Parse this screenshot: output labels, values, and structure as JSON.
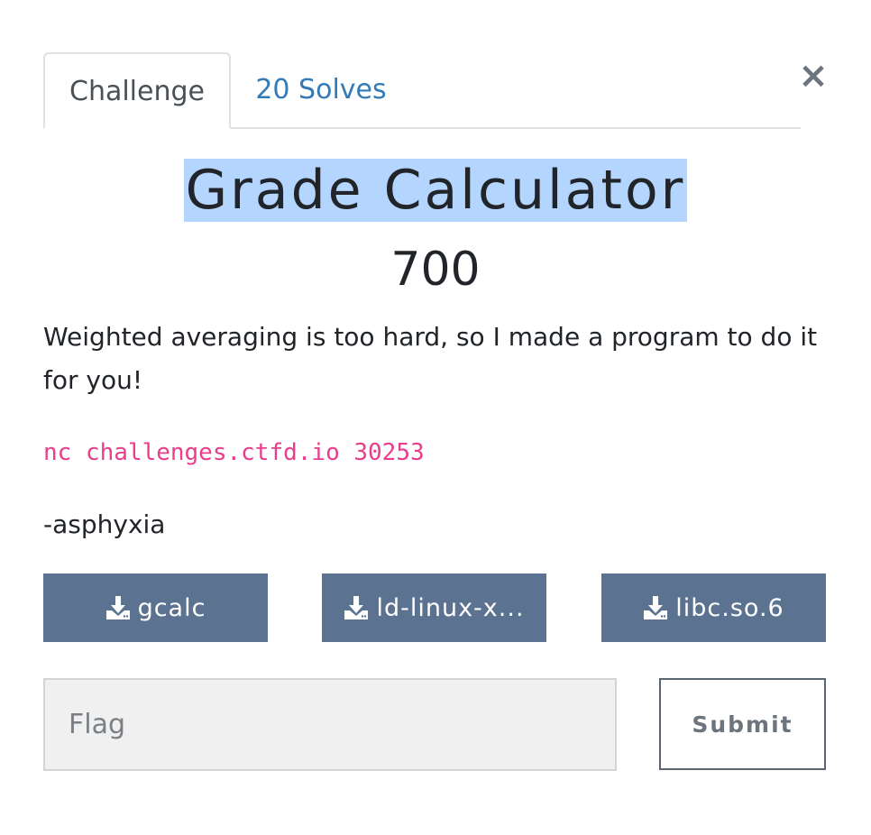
{
  "tabs": {
    "challenge_label": "Challenge",
    "solves_label": "20 Solves"
  },
  "close_symbol": "×",
  "challenge": {
    "name": "Grade Calculator",
    "points": "700",
    "description": "Weighted averaging is too hard, so I made a program to do it for you!",
    "connection": "nc challenges.ctfd.io 30253",
    "author": "-asphyxia"
  },
  "files": [
    {
      "label": "gcalc",
      "icon": "download-icon"
    },
    {
      "label": "ld-linux-x...",
      "icon": "download-icon"
    },
    {
      "label": "libc.so.6",
      "icon": "download-icon"
    }
  ],
  "flag_form": {
    "placeholder": "Flag",
    "value": "",
    "submit_label": "Submit"
  },
  "colors": {
    "file_button_bg": "#5b7290",
    "link": "#337ab7",
    "code": "#e83e8c",
    "title_highlight": "#b4d5fe"
  }
}
